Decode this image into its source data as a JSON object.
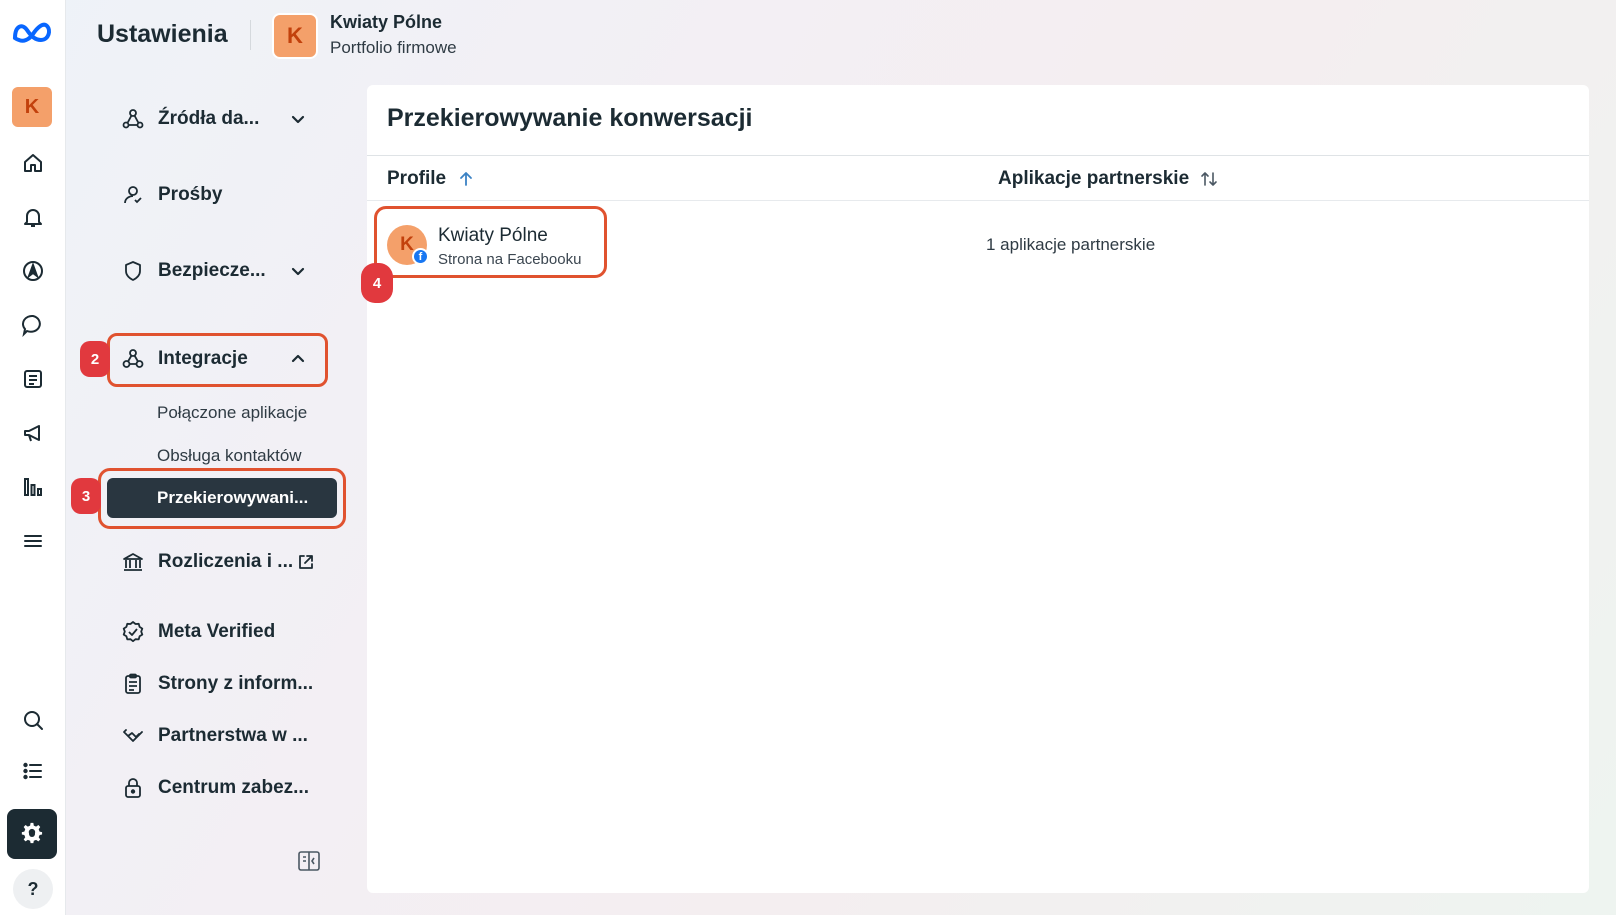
{
  "header": {
    "title": "Ustawienia",
    "business_initial": "K",
    "business_name": "Kwiaty Pólne",
    "business_subtitle": "Portfolio firmowe"
  },
  "rail": {
    "avatar_initial": "K",
    "icons": [
      "meta-logo",
      "home-icon",
      "bell-icon",
      "compass-icon",
      "chat-icon",
      "newspaper-icon",
      "megaphone-icon",
      "chart-icon",
      "menu-icon",
      "search-icon",
      "list-icon",
      "gear-icon",
      "help-icon"
    ],
    "help_label": "?"
  },
  "sidebar": {
    "items": [
      {
        "label": "Źródła da...",
        "icon": "data-sources-icon",
        "chevron": "down"
      },
      {
        "label": "Prośby",
        "icon": "person-request-icon"
      },
      {
        "label": "Bezpiecze...",
        "icon": "shield-icon",
        "chevron": "down"
      },
      {
        "label": "Integracje",
        "icon": "integrations-icon",
        "chevron": "up"
      },
      {
        "label": "Rozliczenia i ...",
        "icon": "bank-icon",
        "external": true
      },
      {
        "label": "Meta Verified",
        "icon": "verified-icon"
      },
      {
        "label": "Strony z inform...",
        "icon": "clipboard-icon"
      },
      {
        "label": "Partnerstwa w ...",
        "icon": "handshake-icon"
      },
      {
        "label": "Centrum zabez...",
        "icon": "lock-icon"
      }
    ],
    "subitems": [
      {
        "label": "Połączone aplikacje"
      },
      {
        "label": "Obsługa kontaktów"
      },
      {
        "label": "Przekierowywani...",
        "active": true
      }
    ],
    "badges": [
      "2",
      "3",
      "4"
    ]
  },
  "main": {
    "title": "Przekierowywanie konwersacji",
    "columns": [
      "Profile",
      "Aplikacje partnerskie"
    ],
    "rows": [
      {
        "initial": "K",
        "name": "Kwiaty Pólne",
        "subtitle": "Strona na Facebooku",
        "apps": "1 aplikacje partnerskie"
      }
    ]
  },
  "colors": {
    "highlight": "#e0522f",
    "badge": "#e1393e",
    "active_nav": "#293640",
    "avatar": "#f4a06a",
    "facebook": "#1877f2"
  }
}
